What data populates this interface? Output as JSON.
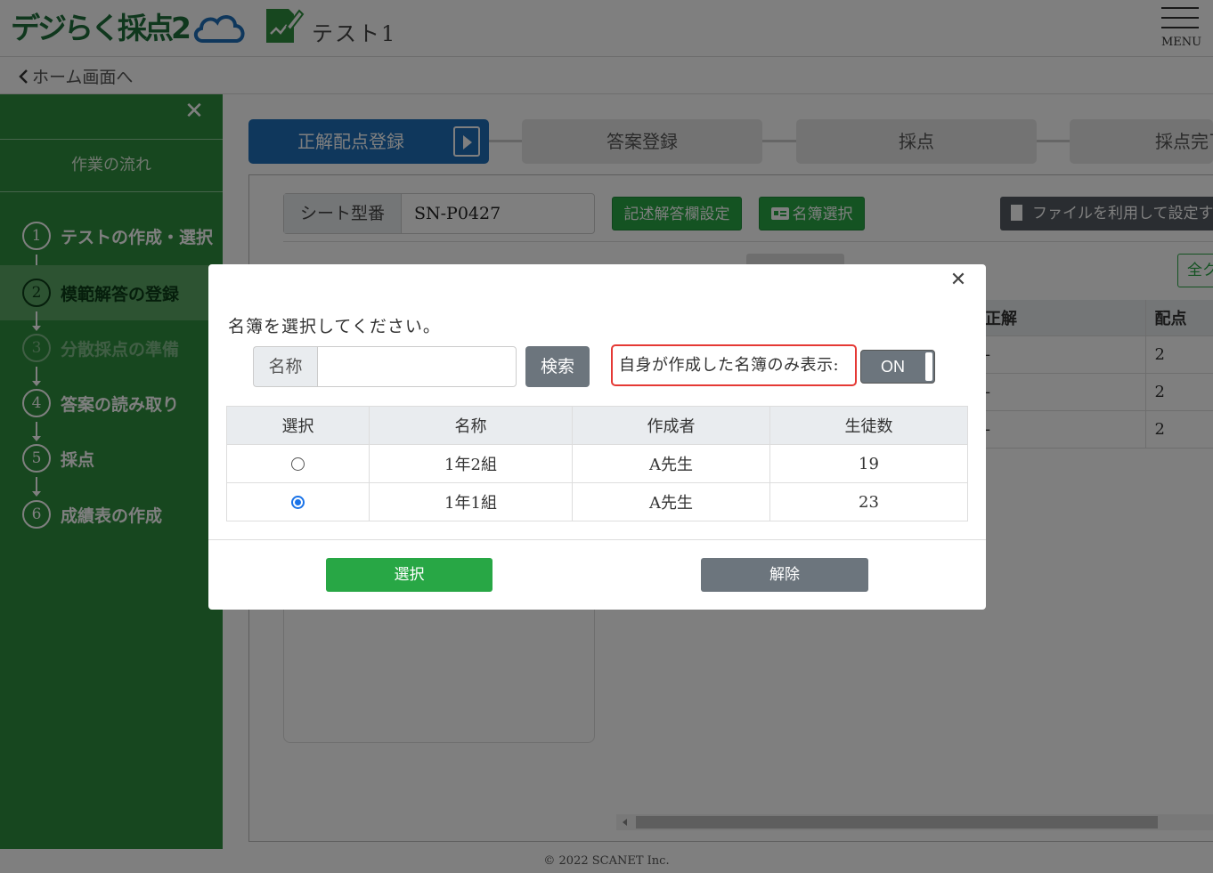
{
  "header": {
    "logo_text": "デジらく採点",
    "logo_num": "2",
    "test_name": "テスト1",
    "menu_label": "MENU"
  },
  "breadcrumb": {
    "home_link": "ホーム画面へ"
  },
  "sidebar": {
    "title": "作業の流れ",
    "steps": [
      {
        "num": "1",
        "label": "テストの作成・選択"
      },
      {
        "num": "2",
        "label": "模範解答の登録"
      },
      {
        "num": "3",
        "label": "分散採点の準備"
      },
      {
        "num": "4",
        "label": "答案の読み取り"
      },
      {
        "num": "5",
        "label": "採点"
      },
      {
        "num": "6",
        "label": "成績表の作成"
      }
    ]
  },
  "wizard": {
    "steps": [
      "正解配点登録",
      "答案登録",
      "採点",
      "採点完了"
    ]
  },
  "panel": {
    "sheet_label": "シート型番",
    "sheet_value": "SN-P0427",
    "desc_btn": "記述解答欄設定",
    "roster_btn": "名簿選択",
    "file_btn": "ファイルを利用して設定す",
    "all_btn": "全ク",
    "answer_table": {
      "headers": [
        "正解",
        "配点"
      ],
      "rows": [
        [
          "-",
          "2"
        ],
        [
          "-",
          "2"
        ],
        [
          "-",
          "2"
        ]
      ]
    }
  },
  "modal": {
    "prompt": "名簿を選択してください。",
    "name_label": "名称",
    "name_value": "",
    "search_btn": "検索",
    "own_only_label": "自身が作成した名簿のみ表示:",
    "toggle": "ON",
    "table": {
      "headers": [
        "選択",
        "名称",
        "作成者",
        "生徒数"
      ],
      "rows": [
        {
          "selected": false,
          "name": "1年2組",
          "author": "A先生",
          "count": "19"
        },
        {
          "selected": true,
          "name": "1年1組",
          "author": "A先生",
          "count": "23"
        }
      ]
    },
    "select_btn": "選択",
    "release_btn": "解除"
  },
  "footer": "© 2022 SCANET Inc.",
  "colors": {
    "brand_green": "#1f6f3a",
    "sidebar_green": "#2f8f3e",
    "primary_blue": "#1e6eb8",
    "success": "#28a745",
    "secondary": "#6c757d",
    "highlight_red": "#e53935"
  }
}
